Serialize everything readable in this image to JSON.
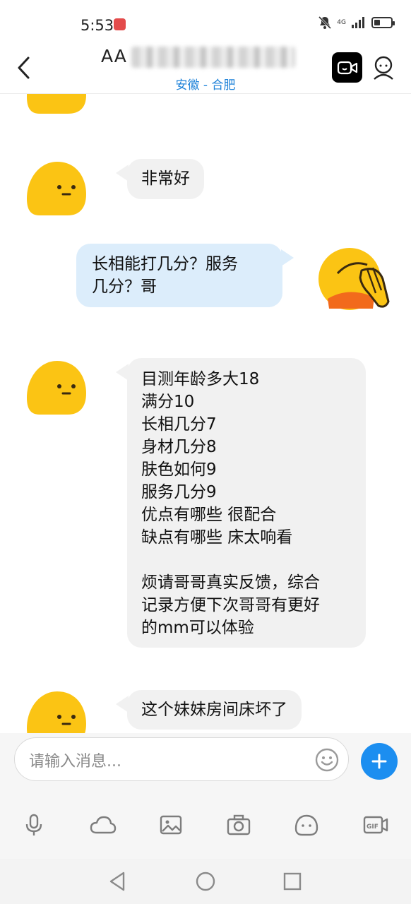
{
  "status": {
    "time": "5:53",
    "network": "4G"
  },
  "header": {
    "title_visible": "AA",
    "subtitle": "安徽 - 合肥"
  },
  "messages": [
    {
      "dir": "in",
      "text": "非常好"
    },
    {
      "dir": "out",
      "text": "长相能打几分？服务\n几分？哥"
    },
    {
      "dir": "in",
      "text": "目测年龄多大18\n满分10\n长相几分7\n身材几分8\n肤色如何9\n服务几分9\n优点有哪些  很配合\n缺点有哪些  床太响看\n\n烦请哥哥真实反馈，综合\n记录方便下次哥哥有更好\n的mm可以体验"
    },
    {
      "dir": "in",
      "text": "这个妹妹房间床坏了"
    }
  ],
  "input": {
    "placeholder": "请输入消息..."
  },
  "toolbar": [
    "mic-icon",
    "cloud-icon",
    "image-icon",
    "camera-icon",
    "face-icon",
    "gif-icon"
  ],
  "colors": {
    "accent": "#1c8ef0",
    "subtitle": "#1f83d9",
    "incoming_bubble": "#f1f1f1",
    "outgoing_bubble": "#dcedfb",
    "avatar_yellow": "#fbc414"
  }
}
